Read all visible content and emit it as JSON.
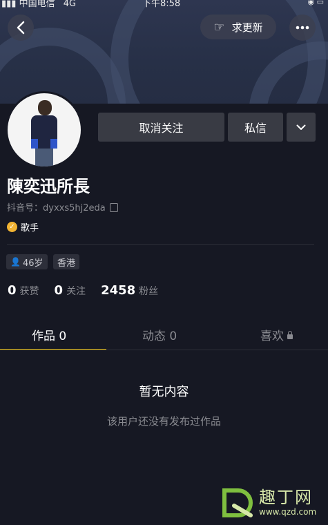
{
  "status_bar": {
    "carrier": "中国电信",
    "network": "4G",
    "time": "下午8:58"
  },
  "header": {
    "update_label": "求更新"
  },
  "profile": {
    "actions": {
      "unfollow_label": "取消关注",
      "message_label": "私信"
    },
    "name": "陳奕迅所長",
    "douyin_id": "抖音号：dyxxs5hj2eda",
    "verified_label": "歌手",
    "tags": {
      "age": "46岁",
      "location": "香港"
    },
    "stats": [
      {
        "value": "0",
        "label": "获赞"
      },
      {
        "value": "0",
        "label": "关注"
      },
      {
        "value": "2458",
        "label": "粉丝"
      }
    ]
  },
  "tabs": [
    {
      "label": "作品 0"
    },
    {
      "label": "动态 0"
    },
    {
      "label": "喜欢"
    }
  ],
  "empty_state": {
    "title": "暂无内容",
    "subtitle": "该用户还没有发布过作品"
  },
  "watermark": {
    "name": "趣丁网",
    "url": "www.qzd.com"
  },
  "colors": {
    "background": "#161823",
    "accent": "#face15",
    "button": "#393b44",
    "verified": "#f2b433"
  }
}
